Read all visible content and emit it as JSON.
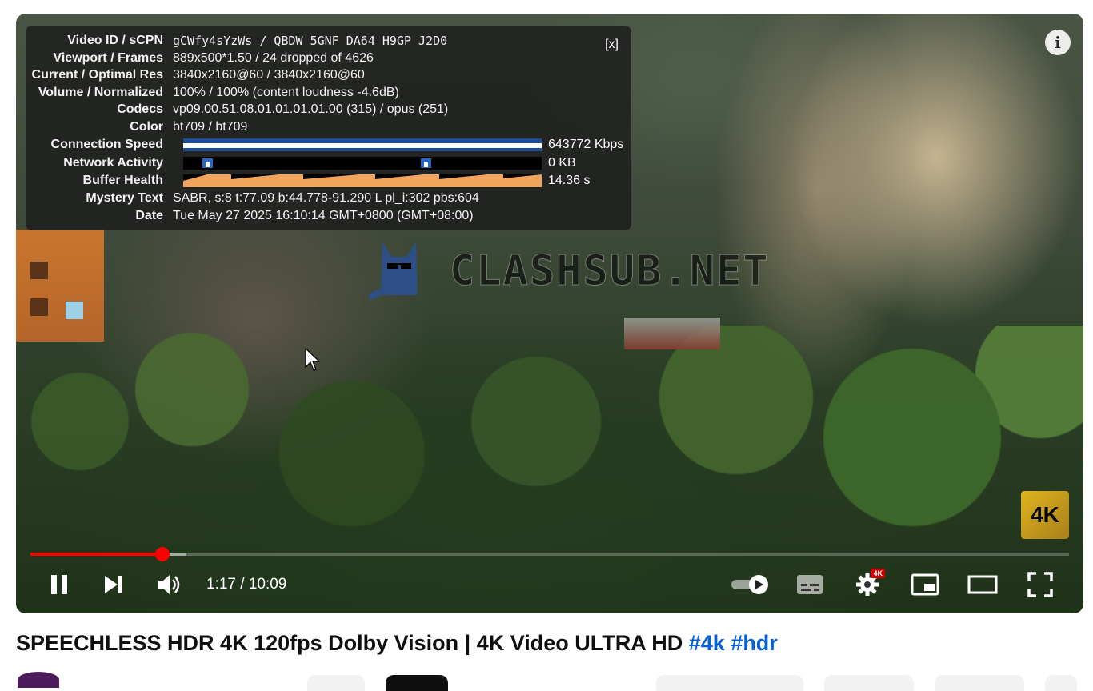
{
  "stats_for_nerds": {
    "close_label": "[x]",
    "rows": [
      {
        "label": "Video ID / sCPN",
        "value": "gCWfy4sYzWs / QBDW 5GNF DA64 H9GP J2D0"
      },
      {
        "label": "Viewport / Frames",
        "value": "889x500*1.50 / 24 dropped of 4626"
      },
      {
        "label": "Current / Optimal Res",
        "value": "3840x2160@60 / 3840x2160@60"
      },
      {
        "label": "Volume / Normalized",
        "value": "100% / 100% (content loudness -4.6dB)"
      },
      {
        "label": "Codecs",
        "value": "vp09.00.51.08.01.01.01.01.00 (315) / opus (251)"
      },
      {
        "label": "Color",
        "value": "bt709 / bt709"
      },
      {
        "label": "Connection Speed",
        "value": "643772 Kbps"
      },
      {
        "label": "Network Activity",
        "value": "0 KB"
      },
      {
        "label": "Buffer Health",
        "value": "14.36 s"
      },
      {
        "label": "Mystery Text",
        "value": "SABR, s:8 t:77.09 b:44.778-91.290 L pl_i:302 pbs:604"
      },
      {
        "label": "Date",
        "value": "Tue May 27 2025 16:10:14 GMT+0800 (GMT+08:00)"
      }
    ]
  },
  "watermark": {
    "text": "CLASHSUB.NET"
  },
  "overlay": {
    "info_icon": "info-icon",
    "quality_badge": "4K"
  },
  "player": {
    "time_display": "1:17 / 10:09",
    "progress_played_fraction": 0.127,
    "progress_buffered_fraction": 0.15,
    "settings_badge": "4K",
    "icons": [
      "pause-icon",
      "next-icon",
      "volume-icon",
      "autoplay-toggle-icon",
      "subtitles-icon",
      "settings-icon",
      "miniplayer-icon",
      "theater-icon",
      "fullscreen-icon"
    ],
    "accent_color": "#ff0000"
  },
  "video": {
    "title_main": "SPEECHLESS HDR 4K 120fps Dolby Vision | 4K Video ULTRA HD ",
    "hashtag_1": "#4k",
    "hashtag_2": "#hdr",
    "hashtag_color": "#065fd4"
  }
}
